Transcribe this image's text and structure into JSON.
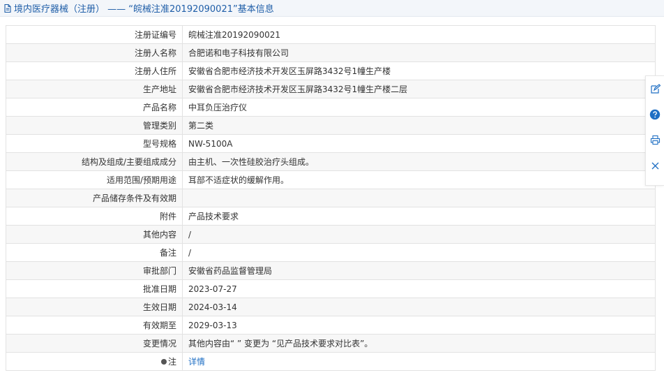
{
  "header": {
    "title": "境内医疗器械（注册） —— “皖械注准20192090021”基本信息"
  },
  "rows": [
    {
      "label": "注册证编号",
      "value": "皖械注准20192090021"
    },
    {
      "label": "注册人名称",
      "value": "合肥诺和电子科技有限公司"
    },
    {
      "label": "注册人住所",
      "value": "安徽省合肥市经济技术开发区玉屏路3432号1幢生产楼"
    },
    {
      "label": "生产地址",
      "value": "安徽省合肥市经济技术开发区玉屏路3432号1幢生产楼二层"
    },
    {
      "label": "产品名称",
      "value": "中耳负压治疗仪"
    },
    {
      "label": "管理类别",
      "value": "第二类"
    },
    {
      "label": "型号规格",
      "value": "NW-5100A"
    },
    {
      "label": "结构及组成/主要组成成分",
      "value": "由主机、一次性硅胶治疗头组成。"
    },
    {
      "label": "适用范围/预期用途",
      "value": "耳部不适症状的缓解作用。"
    },
    {
      "label": "产品储存条件及有效期",
      "value": ""
    },
    {
      "label": "附件",
      "value": "产品技术要求"
    },
    {
      "label": "其他内容",
      "value": "/"
    },
    {
      "label": "备注",
      "value": "/"
    },
    {
      "label": "审批部门",
      "value": "安徽省药品监督管理局"
    },
    {
      "label": "批准日期",
      "value": "2023-07-27"
    },
    {
      "label": "生效日期",
      "value": "2024-03-14"
    },
    {
      "label": "有效期至",
      "value": "2029-03-13"
    },
    {
      "label": "变更情况",
      "value": "其他内容由“ ” 变更为 “见产品技术要求对比表”。"
    }
  ],
  "note_row": {
    "label": "注",
    "link_text": "详情"
  },
  "icons": {
    "title": "document-icon",
    "note": "bulb-icon",
    "side": [
      "edit-icon",
      "help-icon",
      "print-icon",
      "close-icon"
    ]
  },
  "colors": {
    "title_text": "#1f5ea8",
    "link": "#1f6fc4",
    "help_icon": "#1f6fc4"
  }
}
